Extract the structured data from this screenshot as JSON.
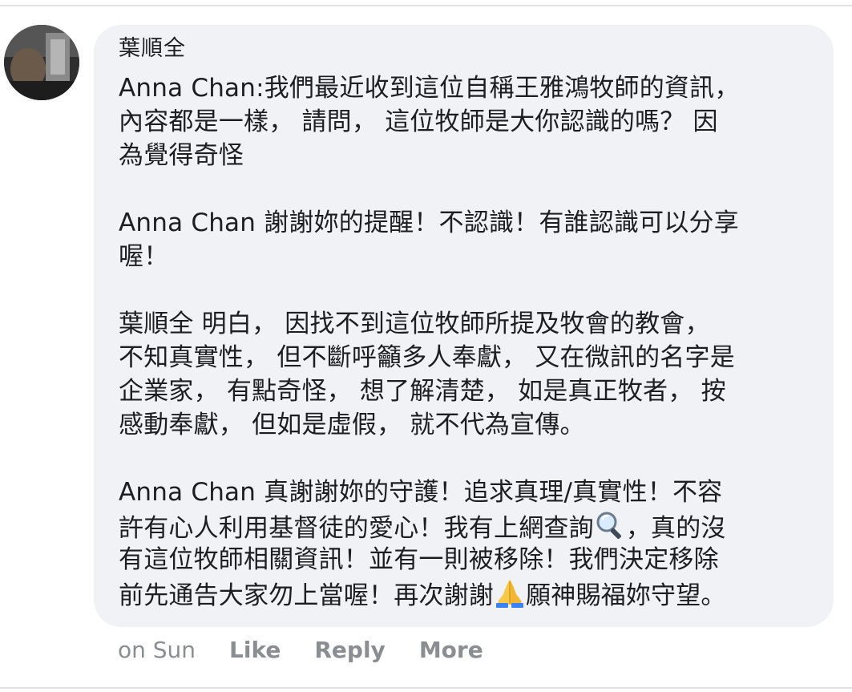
{
  "comment": {
    "author": "葉順全",
    "paragraphs": [
      {
        "lines": [
          "Anna Chan:我們最近收到這位自稱王雅鴻牧師的資訊，",
          "內容都是一樣， 請問， 這位牧師是大你認識的嗎？ 因",
          "為覺得奇怪"
        ]
      },
      {
        "lines": [
          "Anna Chan 謝謝妳的提醒！不認識！有誰認識可以分享",
          "喔！"
        ]
      },
      {
        "lines": [
          "葉順全 明白， 因找不到這位牧師所提及牧會的教會，",
          "不知真實性， 但不斷呼籲多人奉獻， 又在微訊的名字是",
          "企業家， 有點奇怪， 想了解清楚， 如是真正牧者， 按",
          "感動奉獻， 但如是虛假， 就不代為宣傳。"
        ]
      },
      {
        "lines": [
          "Anna Chan 真謝謝妳的守護！追求真理/真實性！不容",
          "許有心人利用基督徒的愛心！我有上網查詢",
          "，真的沒",
          "有這位牧師相關資訊！並有一則被移除！我們決定移除",
          "前先通告大家勿上當喔！再次謝謝",
          "願神賜福妳守望。"
        ]
      }
    ]
  },
  "actions": {
    "timestamp": "on Sun",
    "like": "Like",
    "reply": "Reply",
    "more": "More"
  },
  "icons": {
    "magnifier": "magnifying-glass-emoji",
    "pray": "folded-hands-emoji"
  },
  "colors": {
    "bubble_bg": "#f0f2f5",
    "text": "#1c1e21",
    "meta": "#8a8d91"
  }
}
